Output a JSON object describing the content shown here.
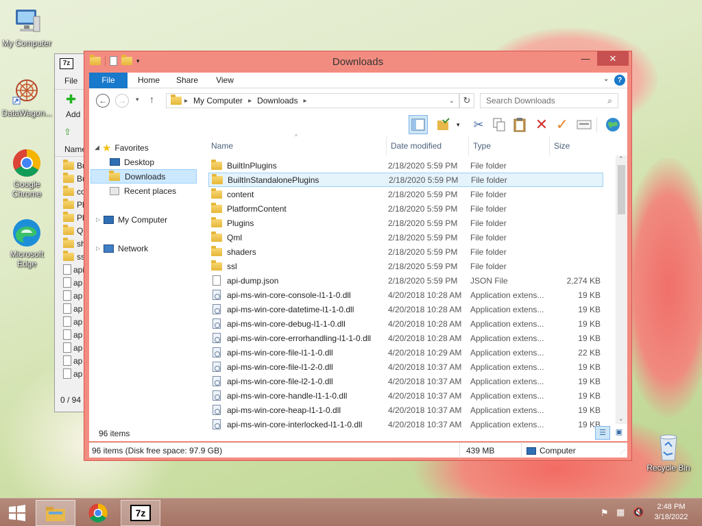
{
  "desktop": {
    "icons": [
      {
        "id": "my-computer",
        "label": "My Computer"
      },
      {
        "id": "datawagon",
        "label": "DataWagon..."
      },
      {
        "id": "chrome",
        "label": "Google Chrome"
      },
      {
        "id": "edge",
        "label": "Microsoft Edge"
      },
      {
        "id": "recycle-bin",
        "label": "Recycle Bin"
      }
    ]
  },
  "zip_window": {
    "logo": "7z",
    "menu_file": "File",
    "add_label": "Add",
    "col_name": "Name",
    "rows": [
      "Bu",
      "Bu",
      "co",
      "Pla",
      "Plu",
      "Qn",
      "sh",
      "ssl",
      "api",
      "ap",
      "ap",
      "ap",
      "ap",
      "ap",
      "ap",
      "ap",
      "ap"
    ],
    "status": "0 / 94"
  },
  "explorer": {
    "title": "Downloads",
    "tabs": {
      "file": "File",
      "home": "Home",
      "share": "Share",
      "view": "View"
    },
    "breadcrumb": [
      "My Computer",
      "Downloads"
    ],
    "search_placeholder": "Search Downloads",
    "nav": {
      "favorites": "Favorites",
      "desktop": "Desktop",
      "downloads": "Downloads",
      "recent": "Recent places",
      "my_computer": "My Computer",
      "network": "Network"
    },
    "columns": {
      "name": "Name",
      "date": "Date modified",
      "type": "Type",
      "size": "Size"
    },
    "files": [
      {
        "name": "BuiltInPlugins",
        "date": "2/18/2020 5:59 PM",
        "type": "File folder",
        "size": "",
        "kind": "folder"
      },
      {
        "name": "BuiltInStandalonePlugins",
        "date": "2/18/2020 5:59 PM",
        "type": "File folder",
        "size": "",
        "kind": "folder"
      },
      {
        "name": "content",
        "date": "2/18/2020 5:59 PM",
        "type": "File folder",
        "size": "",
        "kind": "folder"
      },
      {
        "name": "PlatformContent",
        "date": "2/18/2020 5:59 PM",
        "type": "File folder",
        "size": "",
        "kind": "folder"
      },
      {
        "name": "Plugins",
        "date": "2/18/2020 5:59 PM",
        "type": "File folder",
        "size": "",
        "kind": "folder"
      },
      {
        "name": "Qml",
        "date": "2/18/2020 5:59 PM",
        "type": "File folder",
        "size": "",
        "kind": "folder"
      },
      {
        "name": "shaders",
        "date": "2/18/2020 5:59 PM",
        "type": "File folder",
        "size": "",
        "kind": "folder"
      },
      {
        "name": "ssl",
        "date": "2/18/2020 5:59 PM",
        "type": "File folder",
        "size": "",
        "kind": "folder"
      },
      {
        "name": "api-dump.json",
        "date": "2/18/2020 5:59 PM",
        "type": "JSON File",
        "size": "2,274 KB",
        "kind": "doc"
      },
      {
        "name": "api-ms-win-core-console-l1-1-0.dll",
        "date": "4/20/2018 10:28 AM",
        "type": "Application extens...",
        "size": "19 KB",
        "kind": "dll"
      },
      {
        "name": "api-ms-win-core-datetime-l1-1-0.dll",
        "date": "4/20/2018 10:28 AM",
        "type": "Application extens...",
        "size": "19 KB",
        "kind": "dll"
      },
      {
        "name": "api-ms-win-core-debug-l1-1-0.dll",
        "date": "4/20/2018 10:28 AM",
        "type": "Application extens...",
        "size": "19 KB",
        "kind": "dll"
      },
      {
        "name": "api-ms-win-core-errorhandling-l1-1-0.dll",
        "date": "4/20/2018 10:28 AM",
        "type": "Application extens...",
        "size": "19 KB",
        "kind": "dll"
      },
      {
        "name": "api-ms-win-core-file-l1-1-0.dll",
        "date": "4/20/2018 10:29 AM",
        "type": "Application extens...",
        "size": "22 KB",
        "kind": "dll"
      },
      {
        "name": "api-ms-win-core-file-l1-2-0.dll",
        "date": "4/20/2018 10:37 AM",
        "type": "Application extens...",
        "size": "19 KB",
        "kind": "dll"
      },
      {
        "name": "api-ms-win-core-file-l2-1-0.dll",
        "date": "4/20/2018 10:37 AM",
        "type": "Application extens...",
        "size": "19 KB",
        "kind": "dll"
      },
      {
        "name": "api-ms-win-core-handle-l1-1-0.dll",
        "date": "4/20/2018 10:37 AM",
        "type": "Application extens...",
        "size": "19 KB",
        "kind": "dll"
      },
      {
        "name": "api-ms-win-core-heap-l1-1-0.dll",
        "date": "4/20/2018 10:37 AM",
        "type": "Application extens...",
        "size": "19 KB",
        "kind": "dll"
      },
      {
        "name": "api-ms-win-core-interlocked-l1-1-0.dll",
        "date": "4/20/2018 10:37 AM",
        "type": "Application extens...",
        "size": "19 KB",
        "kind": "dll"
      }
    ],
    "selected_index": 1,
    "item_count": "96 items",
    "status_left": "96 items (Disk free space: 97.9 GB)",
    "status_size": "439 MB",
    "status_location": "Computer"
  },
  "taskbar": {
    "time": "2:48 PM",
    "date": "3/18/2022",
    "zip_label": "7z"
  },
  "colors": {
    "accent": "#1979ca",
    "window_frame": "#f38c80",
    "close": "#c75050",
    "selection": "#e5f3fb"
  }
}
